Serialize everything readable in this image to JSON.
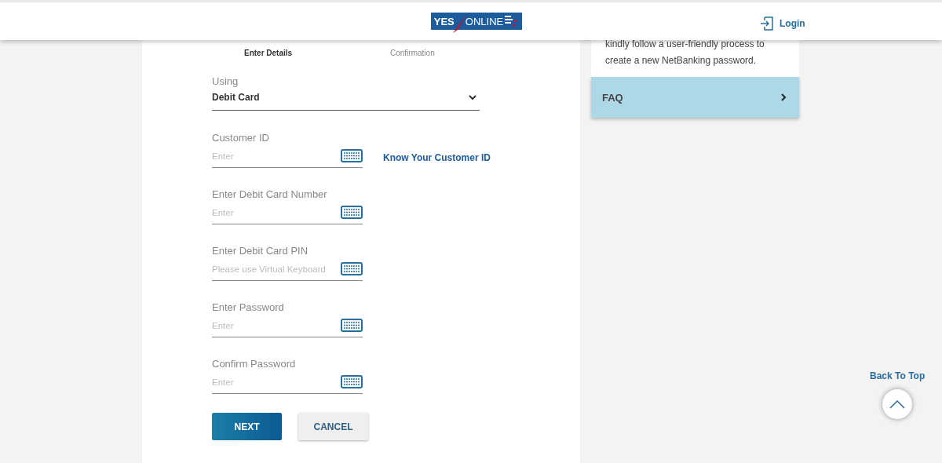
{
  "header": {
    "logo_left": "YES",
    "logo_right": "ONLINE",
    "login": "Login"
  },
  "steps": [
    {
      "label": "Enter Details",
      "selected": true
    },
    {
      "label": "Confirmation",
      "selected": false
    }
  ],
  "fields": [
    {
      "kind": "select",
      "label": "Using",
      "value": "Debit Card"
    },
    {
      "kind": "text",
      "label": "Customer ID",
      "placeholder": "Enter",
      "link": "Know Your Customer ID"
    },
    {
      "kind": "text",
      "label": "Enter Debit Card Number",
      "placeholder": "Enter"
    },
    {
      "kind": "text",
      "label": "Enter Debit Card PIN",
      "placeholder": "Please use Virtual Keyboard"
    },
    {
      "kind": "text",
      "label": "Enter Password",
      "placeholder": "Enter"
    },
    {
      "kind": "text",
      "label": "Confirm Password",
      "placeholder": "Enter"
    }
  ],
  "buttons": [
    {
      "label": "NEXT",
      "kind": "primary"
    },
    {
      "label": "CANCEL",
      "kind": "secondary"
    }
  ],
  "info": {
    "text": "kindly follow a user-friendly process to create a new NetBanking password.",
    "faq": "FAQ"
  },
  "back_to_top": "Back To Top"
}
